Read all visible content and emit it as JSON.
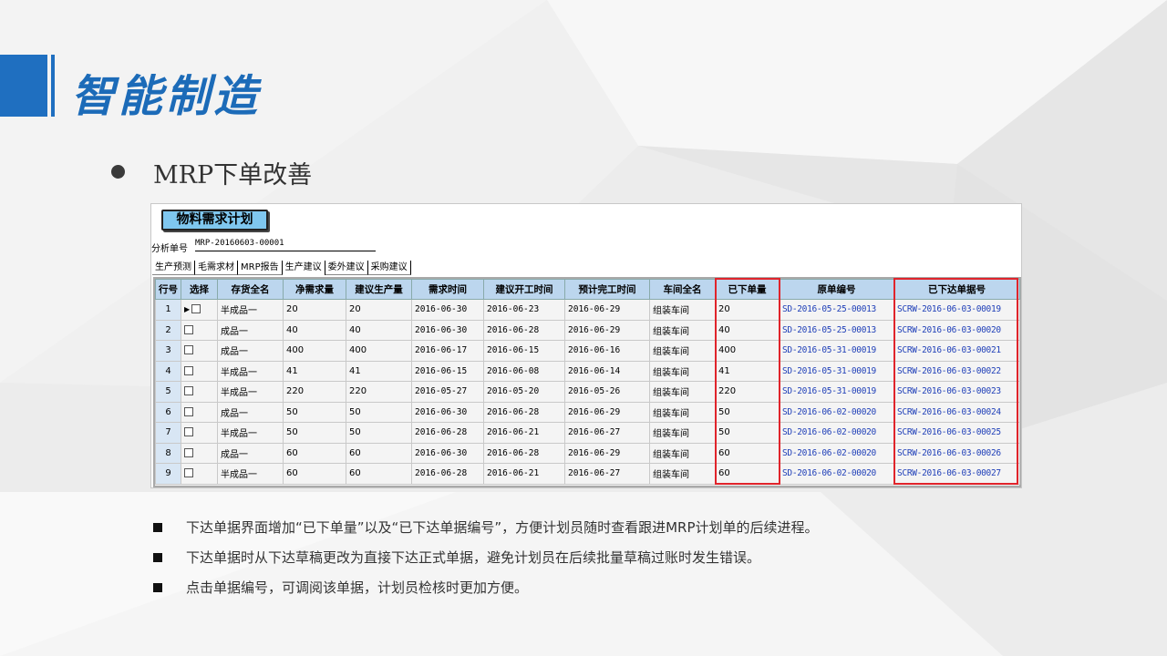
{
  "page_title": "智能制造",
  "section_title": "MRP下单改善",
  "app": {
    "form_title": "物料需求计划",
    "analysis_label": "分析单号",
    "analysis_value": "MRP-20160603-00001",
    "tabs": [
      "生产预测",
      "毛需求材",
      "MRP报告",
      "生产建议",
      "委外建议",
      "采购建议"
    ],
    "active_tab": "生产建议",
    "columns": [
      "行号",
      "选择",
      "存货全名",
      "净需求量",
      "建议生产量",
      "需求时间",
      "建议开工时间",
      "预计完工时间",
      "车间全名",
      "已下单量",
      "原单编号",
      "已下达单据号"
    ],
    "rows": [
      {
        "no": "1",
        "name": "半成品一",
        "net": "20",
        "suggest": "20",
        "need": "2016-06-30",
        "start": "2016-06-23",
        "finish": "2016-06-29",
        "shop": "组装车间",
        "ordered": "20",
        "origin": "SD-2016-05-25-00013",
        "issued": "SCRW-2016-06-03-00019"
      },
      {
        "no": "2",
        "name": "成品一",
        "net": "40",
        "suggest": "40",
        "need": "2016-06-30",
        "start": "2016-06-28",
        "finish": "2016-06-29",
        "shop": "组装车间",
        "ordered": "40",
        "origin": "SD-2016-05-25-00013",
        "issued": "SCRW-2016-06-03-00020"
      },
      {
        "no": "3",
        "name": "成品一",
        "net": "400",
        "suggest": "400",
        "need": "2016-06-17",
        "start": "2016-06-15",
        "finish": "2016-06-16",
        "shop": "组装车间",
        "ordered": "400",
        "origin": "SD-2016-05-31-00019",
        "issued": "SCRW-2016-06-03-00021"
      },
      {
        "no": "4",
        "name": "半成品一",
        "net": "41",
        "suggest": "41",
        "need": "2016-06-15",
        "start": "2016-06-08",
        "finish": "2016-06-14",
        "shop": "组装车间",
        "ordered": "41",
        "origin": "SD-2016-05-31-00019",
        "issued": "SCRW-2016-06-03-00022"
      },
      {
        "no": "5",
        "name": "半成品一",
        "net": "220",
        "suggest": "220",
        "need": "2016-05-27",
        "start": "2016-05-20",
        "finish": "2016-05-26",
        "shop": "组装车间",
        "ordered": "220",
        "origin": "SD-2016-05-31-00019",
        "issued": "SCRW-2016-06-03-00023"
      },
      {
        "no": "6",
        "name": "成品一",
        "net": "50",
        "suggest": "50",
        "need": "2016-06-30",
        "start": "2016-06-28",
        "finish": "2016-06-29",
        "shop": "组装车间",
        "ordered": "50",
        "origin": "SD-2016-06-02-00020",
        "issued": "SCRW-2016-06-03-00024"
      },
      {
        "no": "7",
        "name": "半成品一",
        "net": "50",
        "suggest": "50",
        "need": "2016-06-28",
        "start": "2016-06-21",
        "finish": "2016-06-27",
        "shop": "组装车间",
        "ordered": "50",
        "origin": "SD-2016-06-02-00020",
        "issued": "SCRW-2016-06-03-00025"
      },
      {
        "no": "8",
        "name": "成品一",
        "net": "60",
        "suggest": "60",
        "need": "2016-06-30",
        "start": "2016-06-28",
        "finish": "2016-06-29",
        "shop": "组装车间",
        "ordered": "60",
        "origin": "SD-2016-06-02-00020",
        "issued": "SCRW-2016-06-03-00026"
      },
      {
        "no": "9",
        "name": "半成品一",
        "net": "60",
        "suggest": "60",
        "need": "2016-06-28",
        "start": "2016-06-21",
        "finish": "2016-06-27",
        "shop": "组装车间",
        "ordered": "60",
        "origin": "SD-2016-06-02-00020",
        "issued": "SCRW-2016-06-03-00027"
      }
    ]
  },
  "notes": [
    "下达单据界面增加“已下单量”以及“已下达单据编号”，方便计划员随时查看跟进MRP计划单的后续进程。",
    "下达单据时从下达草稿更改为直接下达正式单据，避免计划员在后续批量草稿过账时发生错误。",
    "点击单据编号，可调阅该单据，计划员检核时更加方便。"
  ],
  "colors": {
    "accent": "#1f6fc0",
    "title": "#1c6bb8",
    "header": "#bcd6ee",
    "highlight": "#e0242b",
    "link": "#1f3fb8"
  }
}
